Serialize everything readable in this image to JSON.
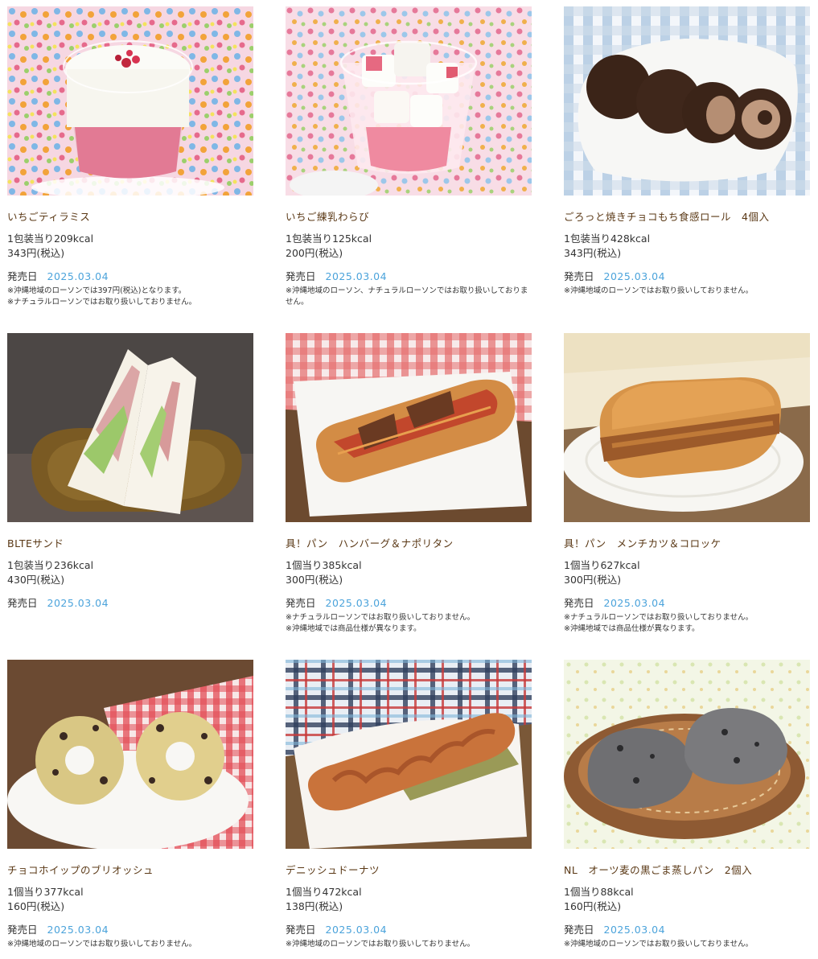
{
  "release_label": "発売日",
  "products": [
    {
      "name": "いちごティラミス",
      "kcal": "1包装当り209kcal",
      "price": "343円(税込)",
      "date": "2025.03.04",
      "notes": [
        "※沖縄地域のローソンでは397円(税込)となります。",
        "※ナチュラルローソンではお取り扱いしておりません。"
      ],
      "image": "strawberry-tiramisu-photo"
    },
    {
      "name": "いちご練乳わらび",
      "kcal": "1包装当り125kcal",
      "price": "200円(税込)",
      "date": "2025.03.04",
      "notes": [
        "※沖縄地域のローソン、ナチュラルローソンではお取り扱いしておりません。"
      ],
      "image": "strawberry-warabi-photo"
    },
    {
      "name": "ごろっと焼きチョコもち食感ロール　4個入",
      "kcal": "1包装当り428kcal",
      "price": "343円(税込)",
      "date": "2025.03.04",
      "notes": [
        "※沖縄地域のローソンではお取り扱いしておりません。"
      ],
      "image": "choco-roll-photo"
    },
    {
      "name": "BLTEサンド",
      "kcal": "1包装当り236kcal",
      "price": "430円(税込)",
      "date": "2025.03.04",
      "notes": [],
      "image": "blte-sandwich-photo"
    },
    {
      "name": "具！パン　ハンバーグ＆ナポリタン",
      "kcal": "1個当り385kcal",
      "price": "300円(税込)",
      "date": "2025.03.04",
      "notes": [
        "※ナチュラルローソンではお取り扱いしておりません。",
        "※沖縄地域では商品仕様が異なります。"
      ],
      "image": "hamburg-napolitan-bread-photo"
    },
    {
      "name": "具！パン　メンチカツ＆コロッケ",
      "kcal": "1個当り627kcal",
      "price": "300円(税込)",
      "date": "2025.03.04",
      "notes": [
        "※ナチュラルローソンではお取り扱いしておりません。",
        "※沖縄地域では商品仕様が異なります。"
      ],
      "image": "menchi-croquette-bread-photo"
    },
    {
      "name": "チョコホイップのブリオッシュ",
      "kcal": "1個当り377kcal",
      "price": "160円(税込)",
      "date": "2025.03.04",
      "notes": [
        "※沖縄地域のローソンではお取り扱いしておりません。"
      ],
      "image": "choco-brioche-photo"
    },
    {
      "name": "デニッシュドーナツ",
      "kcal": "1個当り472kcal",
      "price": "138円(税込)",
      "date": "2025.03.04",
      "notes": [
        "※沖縄地域のローソンではお取り扱いしておりません。"
      ],
      "image": "danish-donut-photo"
    },
    {
      "name": "NL　オーツ麦の黒ごま蒸しパン　2個入",
      "kcal": "1個当り88kcal",
      "price": "160円(税込)",
      "date": "2025.03.04",
      "notes": [
        "※沖縄地域のローソンではお取り扱いしておりません。"
      ],
      "image": "oat-sesame-bun-photo"
    }
  ]
}
